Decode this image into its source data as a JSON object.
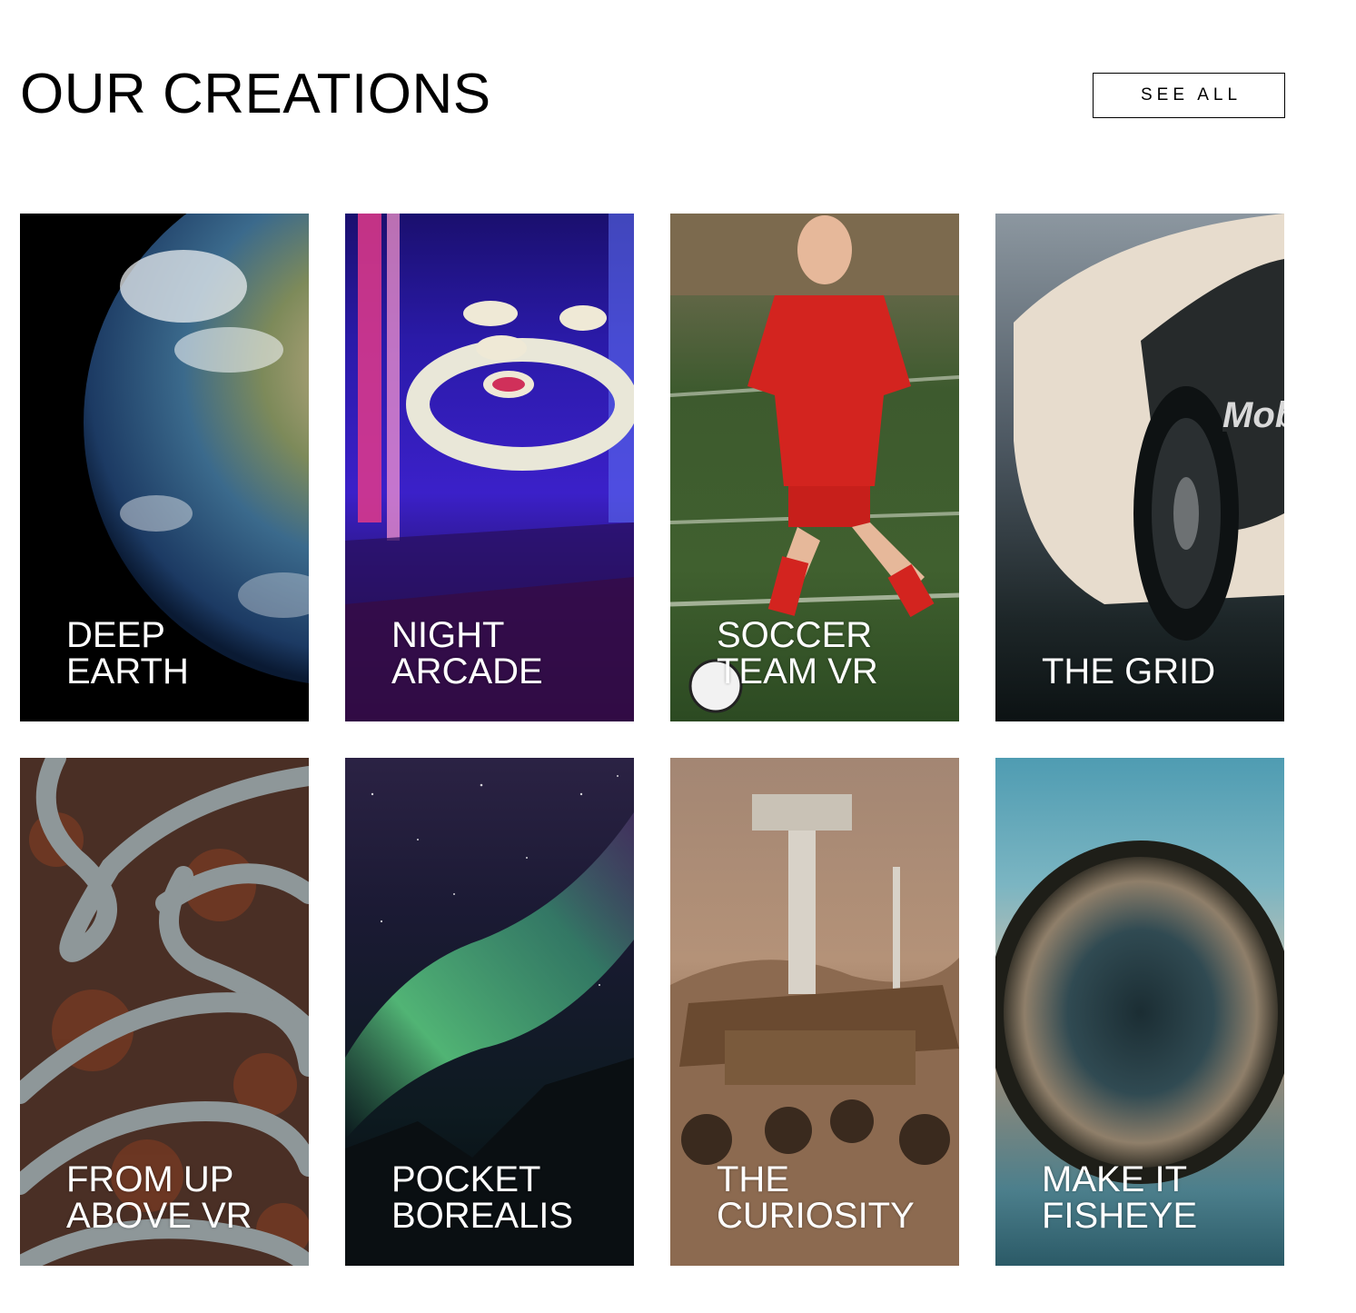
{
  "header": {
    "title": "OUR CREATIONS",
    "see_all_label": "SEE ALL"
  },
  "cards": [
    {
      "name": "deep-earth",
      "lines": [
        "DEEP",
        "EARTH"
      ]
    },
    {
      "name": "night-arcade",
      "lines": [
        "NIGHT",
        "ARCADE"
      ]
    },
    {
      "name": "soccer-team-vr",
      "lines": [
        "SOCCER",
        "TEAM VR"
      ]
    },
    {
      "name": "the-grid",
      "lines": [
        "",
        "THE GRID"
      ]
    },
    {
      "name": "from-up-above-vr",
      "lines": [
        "FROM UP",
        "ABOVE VR"
      ]
    },
    {
      "name": "pocket-borealis",
      "lines": [
        "POCKET",
        "BOREALIS"
      ]
    },
    {
      "name": "the-curiosity",
      "lines": [
        "THE",
        "CURIOSITY"
      ]
    },
    {
      "name": "make-it-fisheye",
      "lines": [
        "MAKE IT",
        "FISHEYE"
      ]
    }
  ],
  "colors": {
    "text": "#000000",
    "card_label": "#ffffff",
    "background": "#ffffff"
  }
}
